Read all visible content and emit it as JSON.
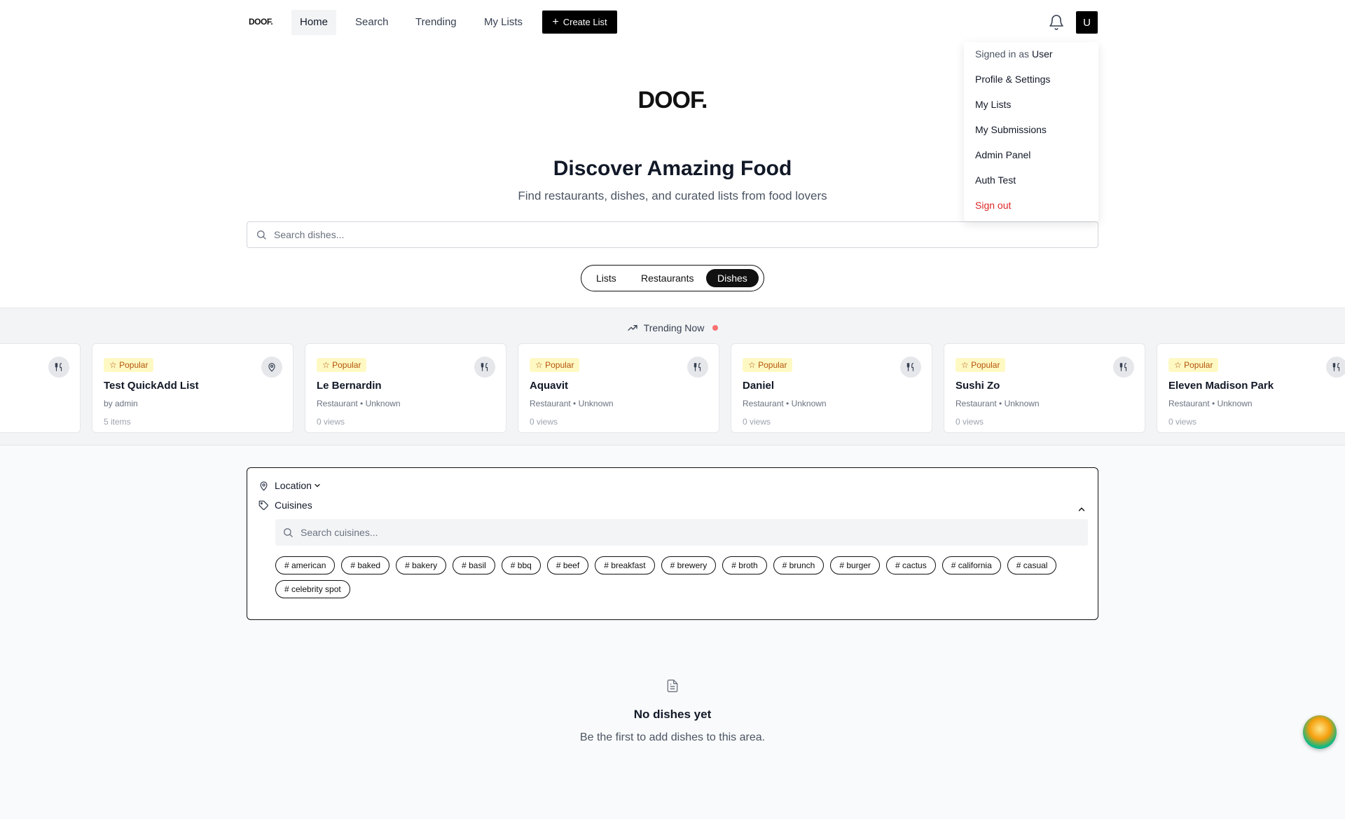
{
  "nav": {
    "logo": "DOOF.",
    "links": [
      "Home",
      "Search",
      "Trending",
      "My Lists"
    ],
    "create_label": "Create List",
    "avatar_initial": "U"
  },
  "user_menu": {
    "signed_in_prefix": "Signed in as",
    "user_name": "User",
    "items": [
      "Profile & Settings",
      "My Lists",
      "My Submissions",
      "Admin Panel",
      "Auth Test"
    ],
    "sign_out": "Sign out"
  },
  "hero": {
    "logo": "DOOF.",
    "title": "Discover Amazing Food",
    "subtitle": "Find restaurants, dishes, and curated lists from food lovers",
    "search_placeholder": "Search dishes..."
  },
  "tabs": {
    "items": [
      "Lists",
      "Restaurants",
      "Dishes"
    ],
    "active": "Dishes"
  },
  "trending": {
    "heading": "Trending Now",
    "cards": [
      {
        "badge": "",
        "title": "",
        "meta": "",
        "views": "",
        "icon": "utensils-icon"
      },
      {
        "badge": "Popular",
        "title": "Test QuickAdd List",
        "meta": "by admin",
        "views": "5 items",
        "icon": "map-pin-icon"
      },
      {
        "badge": "Popular",
        "title": "Le Bernardin",
        "meta": "Restaurant • Unknown",
        "views": "0 views",
        "icon": "utensils-icon"
      },
      {
        "badge": "Popular",
        "title": "Aquavit",
        "meta": "Restaurant • Unknown",
        "views": "0 views",
        "icon": "utensils-icon"
      },
      {
        "badge": "Popular",
        "title": "Daniel",
        "meta": "Restaurant • Unknown",
        "views": "0 views",
        "icon": "utensils-icon"
      },
      {
        "badge": "Popular",
        "title": "Sushi Zo",
        "meta": "Restaurant • Unknown",
        "views": "0 views",
        "icon": "utensils-icon"
      },
      {
        "badge": "Popular",
        "title": "Eleven Madison Park",
        "meta": "Restaurant • Unknown",
        "views": "0 views",
        "icon": "utensils-icon"
      }
    ]
  },
  "filters": {
    "location_label": "Location",
    "cuisines_label": "Cuisines",
    "cuisine_search_placeholder": "Search cuisines...",
    "cuisines": [
      "# american",
      "# baked",
      "# bakery",
      "# basil",
      "# bbq",
      "# beef",
      "# breakfast",
      "# brewery",
      "# broth",
      "# brunch",
      "# burger",
      "# cactus",
      "# california",
      "# casual",
      "# celebrity spot"
    ]
  },
  "empty_state": {
    "title": "No dishes yet",
    "subtitle": "Be the first to add dishes to this area."
  },
  "colors": {
    "accent": "#000000",
    "badge_bg": "#fef9c3",
    "badge_text": "#b45309",
    "sign_out": "#dc2626",
    "trend_dot": "#f87171"
  }
}
